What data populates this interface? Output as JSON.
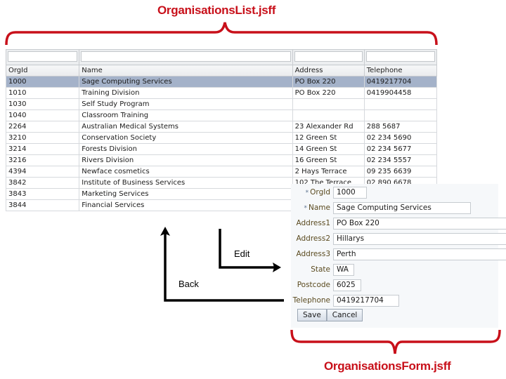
{
  "annotations": {
    "list_page_label": "OrganisationsList.jsff",
    "form_page_label": "OrganisationsForm.jsff",
    "edit_label": "Edit",
    "back_label": "Back",
    "accent_color": "#c8101a"
  },
  "table": {
    "columns": [
      "OrgId",
      "Name",
      "Address",
      "Telephone"
    ],
    "filters": [
      "",
      "",
      "",
      ""
    ],
    "rows": [
      {
        "org_id": "1000",
        "name": "Sage Computing Services",
        "address": "PO Box 220",
        "telephone": "0419217704",
        "selected": true
      },
      {
        "org_id": "1010",
        "name": "Training Division",
        "address": "PO Box 220",
        "telephone": "0419904458"
      },
      {
        "org_id": "1030",
        "name": "Self Study Program",
        "address": "",
        "telephone": ""
      },
      {
        "org_id": "1040",
        "name": "Classroom Training",
        "address": "",
        "telephone": ""
      },
      {
        "org_id": "2264",
        "name": "Australian Medical Systems",
        "address": "23 Alexander Rd",
        "telephone": "288 5687"
      },
      {
        "org_id": "3210",
        "name": "Conservation Society",
        "address": "12 Green St",
        "telephone": "02 234 5690"
      },
      {
        "org_id": "3214",
        "name": "Forests Division",
        "address": "14 Green St",
        "telephone": "02 234 5677"
      },
      {
        "org_id": "3216",
        "name": "Rivers Division",
        "address": "16 Green St",
        "telephone": "02 234 5557"
      },
      {
        "org_id": "4394",
        "name": "Newface cosmetics",
        "address": "2 Hays Terrace",
        "telephone": "09 235 6639"
      },
      {
        "org_id": "3842",
        "name": "Institute of Business Services",
        "address": "102 The Terrace",
        "telephone": "02 890 6678"
      },
      {
        "org_id": "3843",
        "name": "Marketing Services",
        "address": "",
        "telephone": ""
      },
      {
        "org_id": "3844",
        "name": "Financial Services",
        "address": "",
        "telephone": ""
      }
    ],
    "selected_row_color": "#a4b2c9"
  },
  "form": {
    "fields": [
      {
        "label": "OrgId",
        "required": true,
        "value": "1000"
      },
      {
        "label": "Name",
        "required": true,
        "value": "Sage Computing Services"
      },
      {
        "label": "Address1",
        "required": false,
        "value": "PO Box 220"
      },
      {
        "label": "Address2",
        "required": false,
        "value": "Hillarys"
      },
      {
        "label": "Address3",
        "required": false,
        "value": "Perth"
      },
      {
        "label": "State",
        "required": false,
        "value": "WA"
      },
      {
        "label": "Postcode",
        "required": false,
        "value": "6025"
      },
      {
        "label": "Telephone",
        "required": false,
        "value": "0419217704"
      }
    ],
    "required_marker": "*",
    "save_label": "Save",
    "cancel_label": "Cancel"
  }
}
